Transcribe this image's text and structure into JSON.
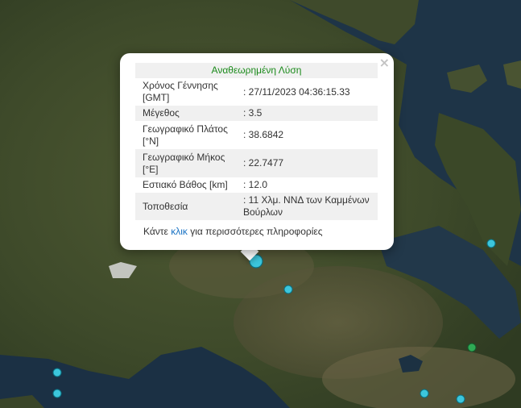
{
  "popup": {
    "title": "Αναθεωρημένη Λύση",
    "rows": [
      {
        "label": "Χρόνος Γέννησης [GMT]",
        "value": ": 27/11/2023 04:36:15.33"
      },
      {
        "label": "Μέγεθος",
        "value": ": 3.5"
      },
      {
        "label": "Γεωγραφικό Πλάτος [°N]",
        "value": ": 38.6842"
      },
      {
        "label": "Γεωγραφικό Μήκος [°E]",
        "value": ": 22.7477"
      },
      {
        "label": "Εστιακό Βάθος [km]",
        "value": ": 12.0"
      },
      {
        "label": "Τοποθεσία",
        "value": ": 11 Χλμ. ΝΝΔ των Καμμένων Βούρλων"
      }
    ],
    "more_prefix": "Κάντε ",
    "more_link": "κλικ",
    "more_suffix": " για περισσότερες πληροφορίες",
    "close_symbol": "×"
  },
  "colors": {
    "marker_cyan": "#3cc6dc",
    "marker_green": "#2faa55",
    "sea": "#1e3447",
    "title_green": "#1a8a1a"
  },
  "icons": [
    "close-icon",
    "earthquake-marker-icon"
  ]
}
